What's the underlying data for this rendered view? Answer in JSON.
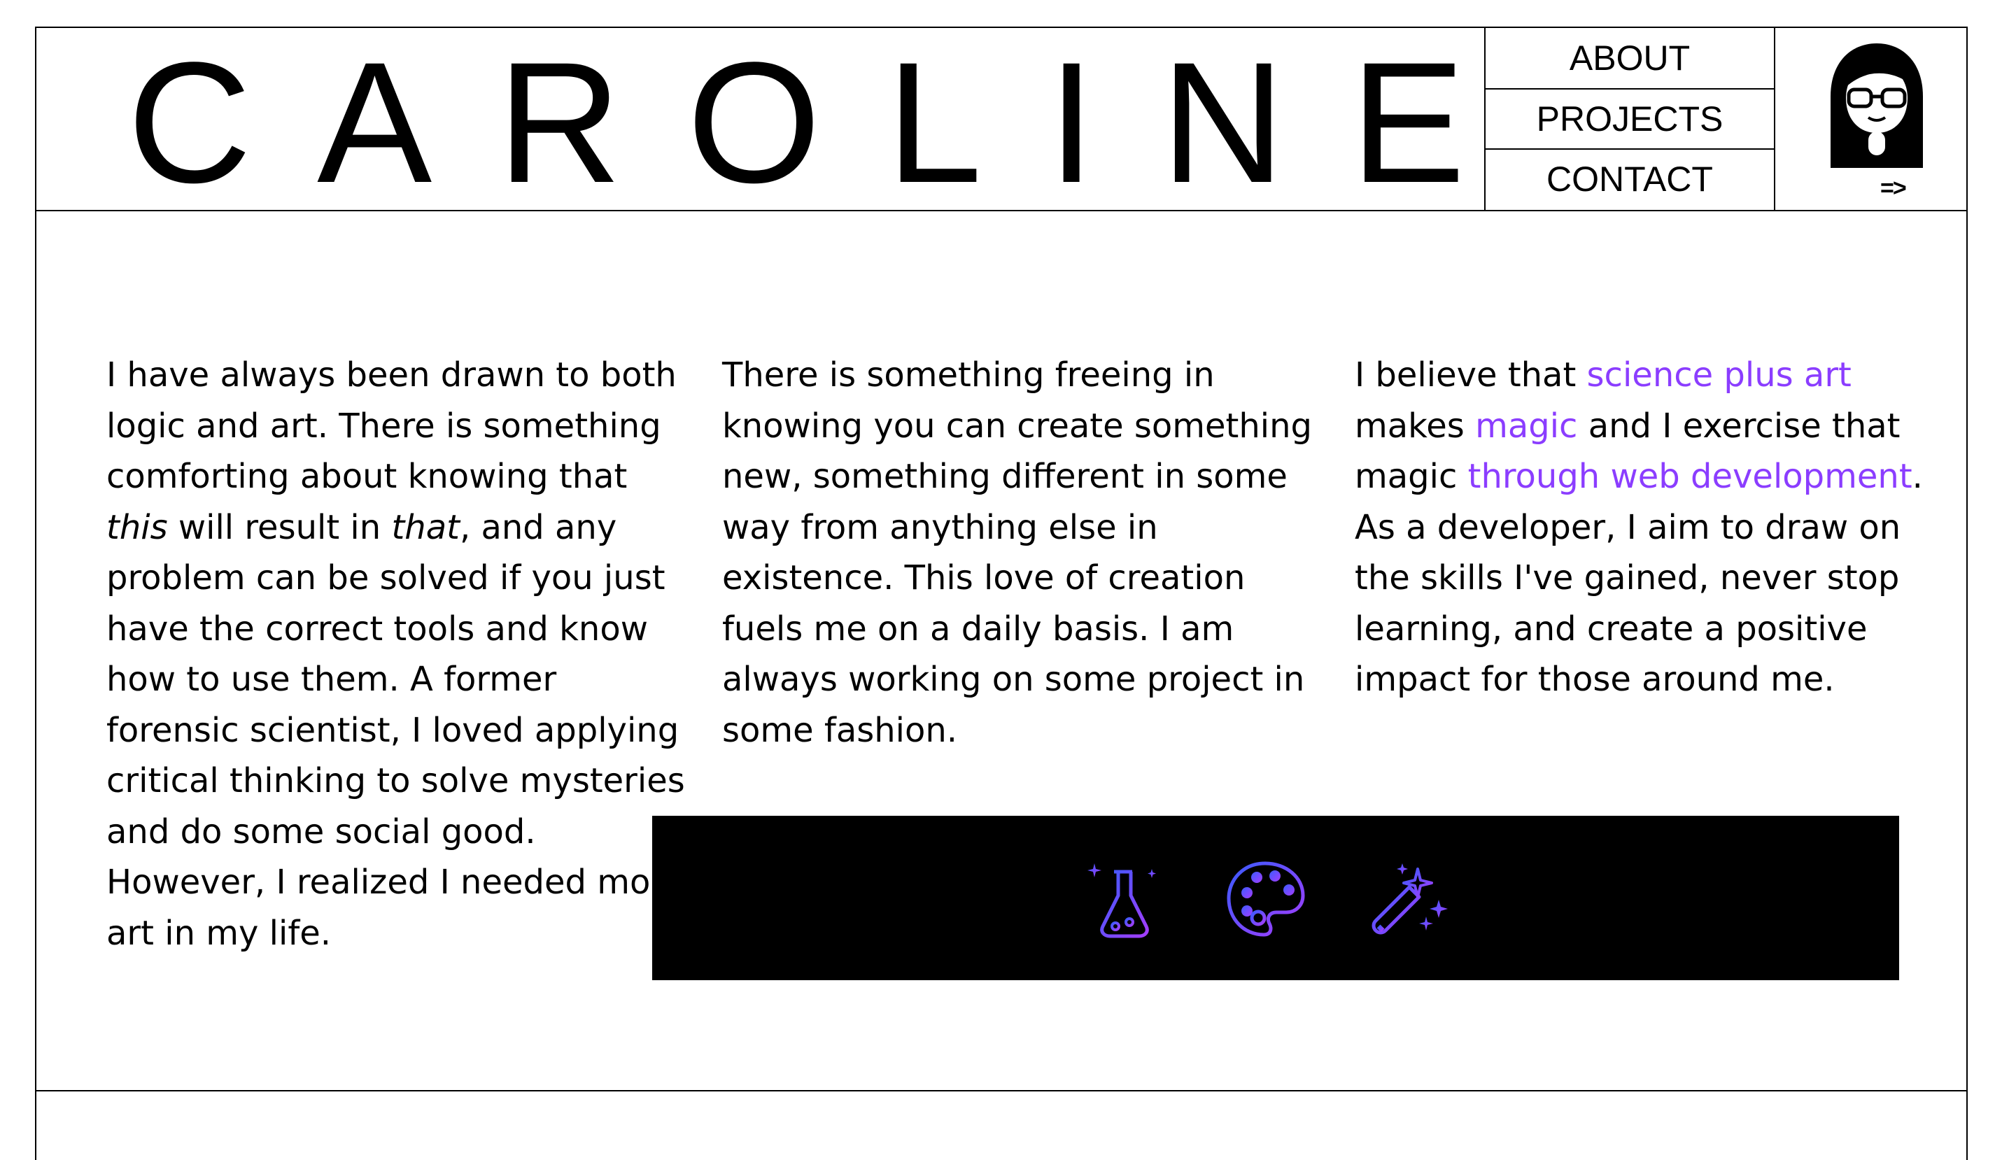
{
  "header": {
    "logo": "CAROLINE",
    "nav": [
      {
        "label": "ABOUT"
      },
      {
        "label": "PROJECTS"
      },
      {
        "label": "CONTACT"
      }
    ],
    "arrow": "=>"
  },
  "about": {
    "col1": {
      "p1": "I have always been drawn to both logic and art. There is something comforting about knowing that ",
      "em1": "this",
      "p2": " will result in ",
      "em2": "that",
      "p3": ", and any problem can be solved if you just have the correct tools and know how to use them. A former forensic scientist, I loved applying critical thinking to solve mysteries and do some social good. However, I realized I needed more art in my life."
    },
    "col2": {
      "text": "There is something freeing in knowing you can create something new, something different in some way from anything else in existence. This love of creation fuels me on a daily basis. I am always working on some project in some fashion."
    },
    "col3": {
      "t1": "I believe that ",
      "h1": "science plus art",
      "t2": " makes ",
      "h2": "magic",
      "t3": " and I exercise that magic ",
      "h3": "through web development",
      "t4": ". As a developer, I aim to draw on the skills I've gained, never stop learning, and create a positive impact for those around me."
    }
  },
  "icons": [
    "flask-icon",
    "palette-icon",
    "magic-wand-icon"
  ],
  "colors": {
    "accent": "#8b3dff",
    "gradient_start": "#3b5bff",
    "gradient_end": "#a43dff",
    "icon_bar_bg": "#000000"
  }
}
